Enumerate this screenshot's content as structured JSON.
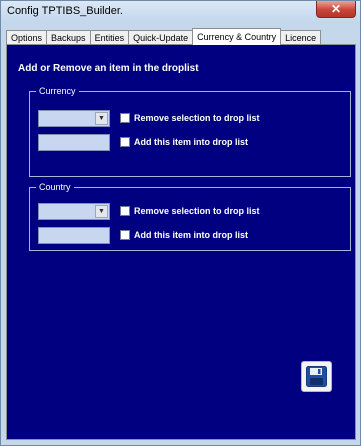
{
  "window": {
    "title": "Config TPTIBS_Builder."
  },
  "tabs": [
    {
      "label": "Options"
    },
    {
      "label": "Backups"
    },
    {
      "label": "Entities"
    },
    {
      "label": "Quick-Update"
    },
    {
      "label": "Currency & Country"
    },
    {
      "label": "Licence"
    }
  ],
  "active_tab": "Currency & Country",
  "heading": "Add or Remove an item in the droplist",
  "currency": {
    "label": "Currency",
    "combo_value": "",
    "field_value": "",
    "remove_label": "Remove selection to drop list",
    "add_label": "Add this item into drop list"
  },
  "country": {
    "label": "Country",
    "combo_value": "",
    "field_value": "",
    "remove_label": "Remove selection to drop list",
    "add_label": "Add this item into drop list"
  },
  "icons": {
    "close": "close-icon",
    "save": "floppy-disk-icon",
    "dropdown": "chevron-down-icon"
  },
  "colors": {
    "panel": "#000080",
    "window": "#c5d7ea",
    "close": "#c8453a"
  }
}
